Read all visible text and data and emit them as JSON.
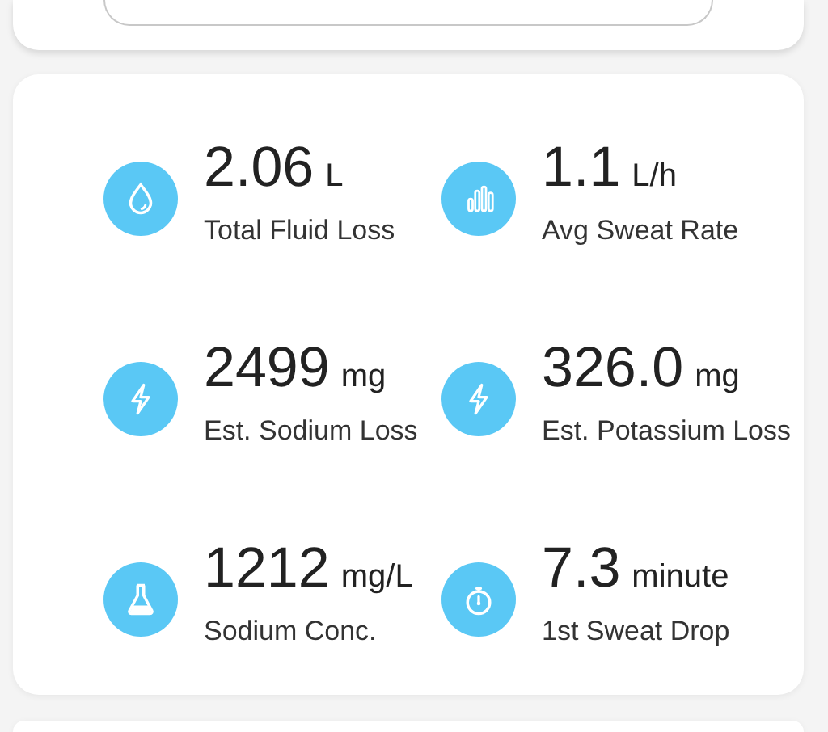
{
  "metrics": [
    {
      "kind": "drop",
      "value": "2.06",
      "unit": "L",
      "label": "Total Fluid Loss"
    },
    {
      "kind": "bars",
      "value": "1.1",
      "unit": "L/h",
      "label": "Avg Sweat Rate"
    },
    {
      "kind": "bolt",
      "value": "2499",
      "unit": "mg",
      "label": "Est. Sodium Loss"
    },
    {
      "kind": "bolt",
      "value": "326.0",
      "unit": "mg",
      "label": "Est. Potassium Loss"
    },
    {
      "kind": "flask",
      "value": "1212",
      "unit": "mg/L",
      "label": "Sodium Conc."
    },
    {
      "kind": "stopwatch",
      "value": "7.3",
      "unit": "minute",
      "label": "1st Sweat Drop"
    }
  ]
}
